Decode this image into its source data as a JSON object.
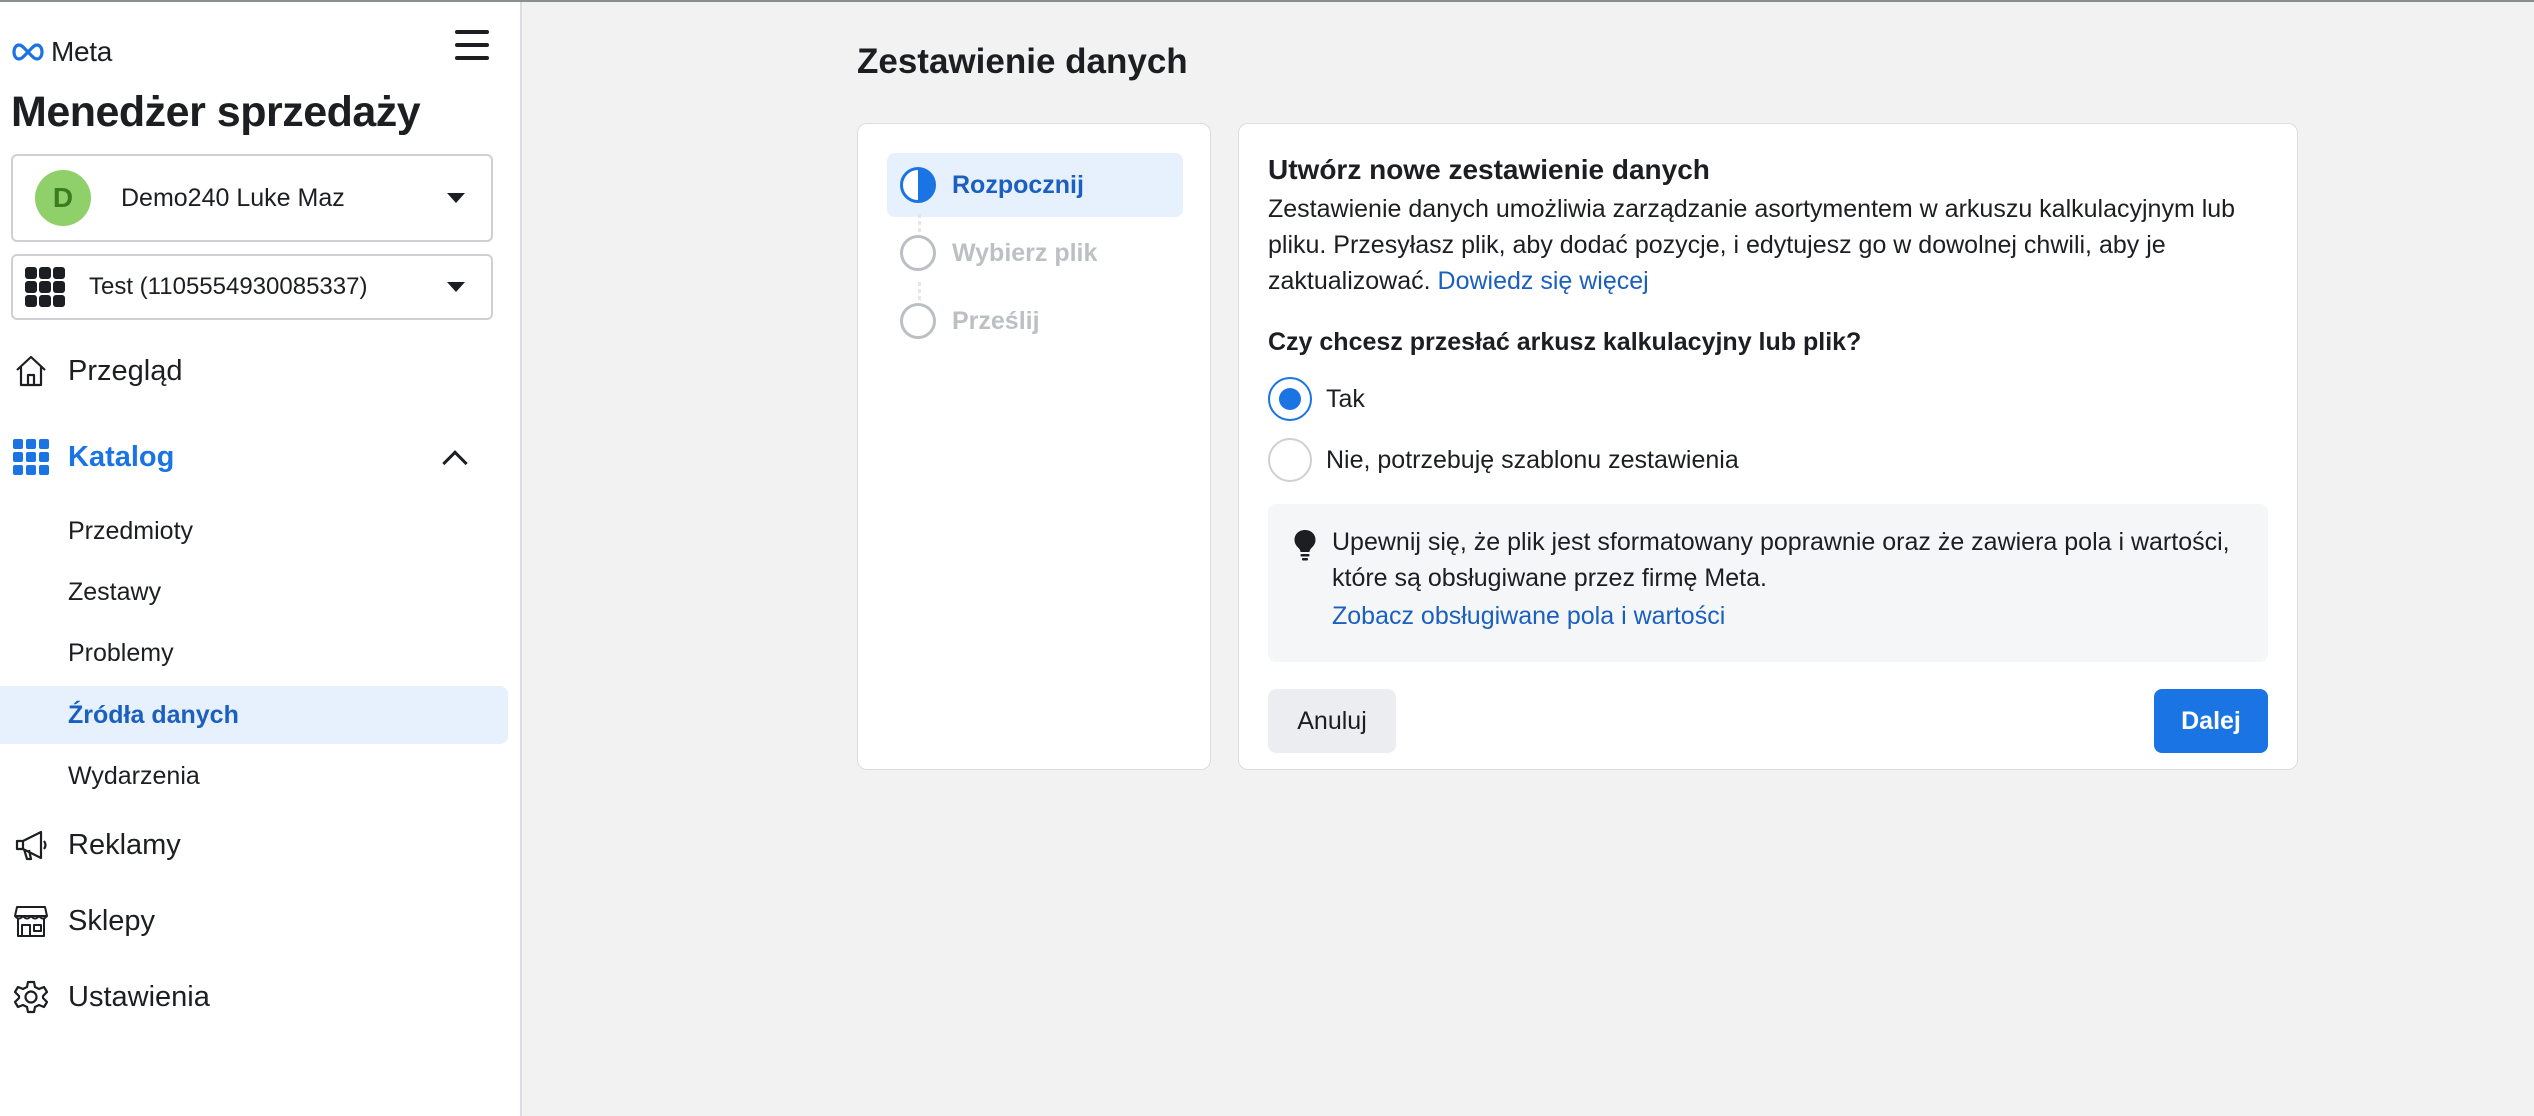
{
  "brand": {
    "logo_text": "Meta",
    "app_title": "Menedżer sprzedaży"
  },
  "business": {
    "avatar_letter": "D",
    "name": "Demo240 Luke Maz"
  },
  "catalog_selector": {
    "name": "Test (1105554930085337)"
  },
  "nav": {
    "overview": "Przegląd",
    "catalog": "Katalog",
    "catalog_sub": [
      "Przedmioty",
      "Zestawy",
      "Problemy",
      "Źródła danych",
      "Wydarzenia"
    ],
    "ads": "Reklamy",
    "shops": "Sklepy",
    "settings": "Ustawienia"
  },
  "page": {
    "title": "Zestawienie danych"
  },
  "steps": [
    "Rozpocznij",
    "Wybierz plik",
    "Prześlij"
  ],
  "form": {
    "title": "Utwórz nowe zestawienie danych",
    "description": "Zestawienie danych umożliwia zarządzanie asortymentem w arkuszu kalkulacyjnym lub pliku. Przesyłasz plik, aby dodać pozycje, i edytujesz go w dowolnej chwili, aby je zaktualizować.",
    "learn_more": "Dowiedz się więcej",
    "question": "Czy chcesz przesłać arkusz kalkulacyjny lub plik?",
    "option_yes": "Tak",
    "option_no": "Nie, potrzebuję szablonu zestawienia",
    "selected_option": "Tak",
    "tip_text": "Upewnij się, że plik jest sformatowany poprawnie oraz że zawiera pola i wartości, które są obsługiwane przez firmę Meta.",
    "tip_link": "Zobacz obsługiwane pola i wartości",
    "cancel": "Anuluj",
    "next": "Dalej"
  },
  "colors": {
    "accent": "#1b74e4",
    "link": "#1b5fbf",
    "selected_bg": "#e7f0fd",
    "avatar": "#8fd06a"
  }
}
